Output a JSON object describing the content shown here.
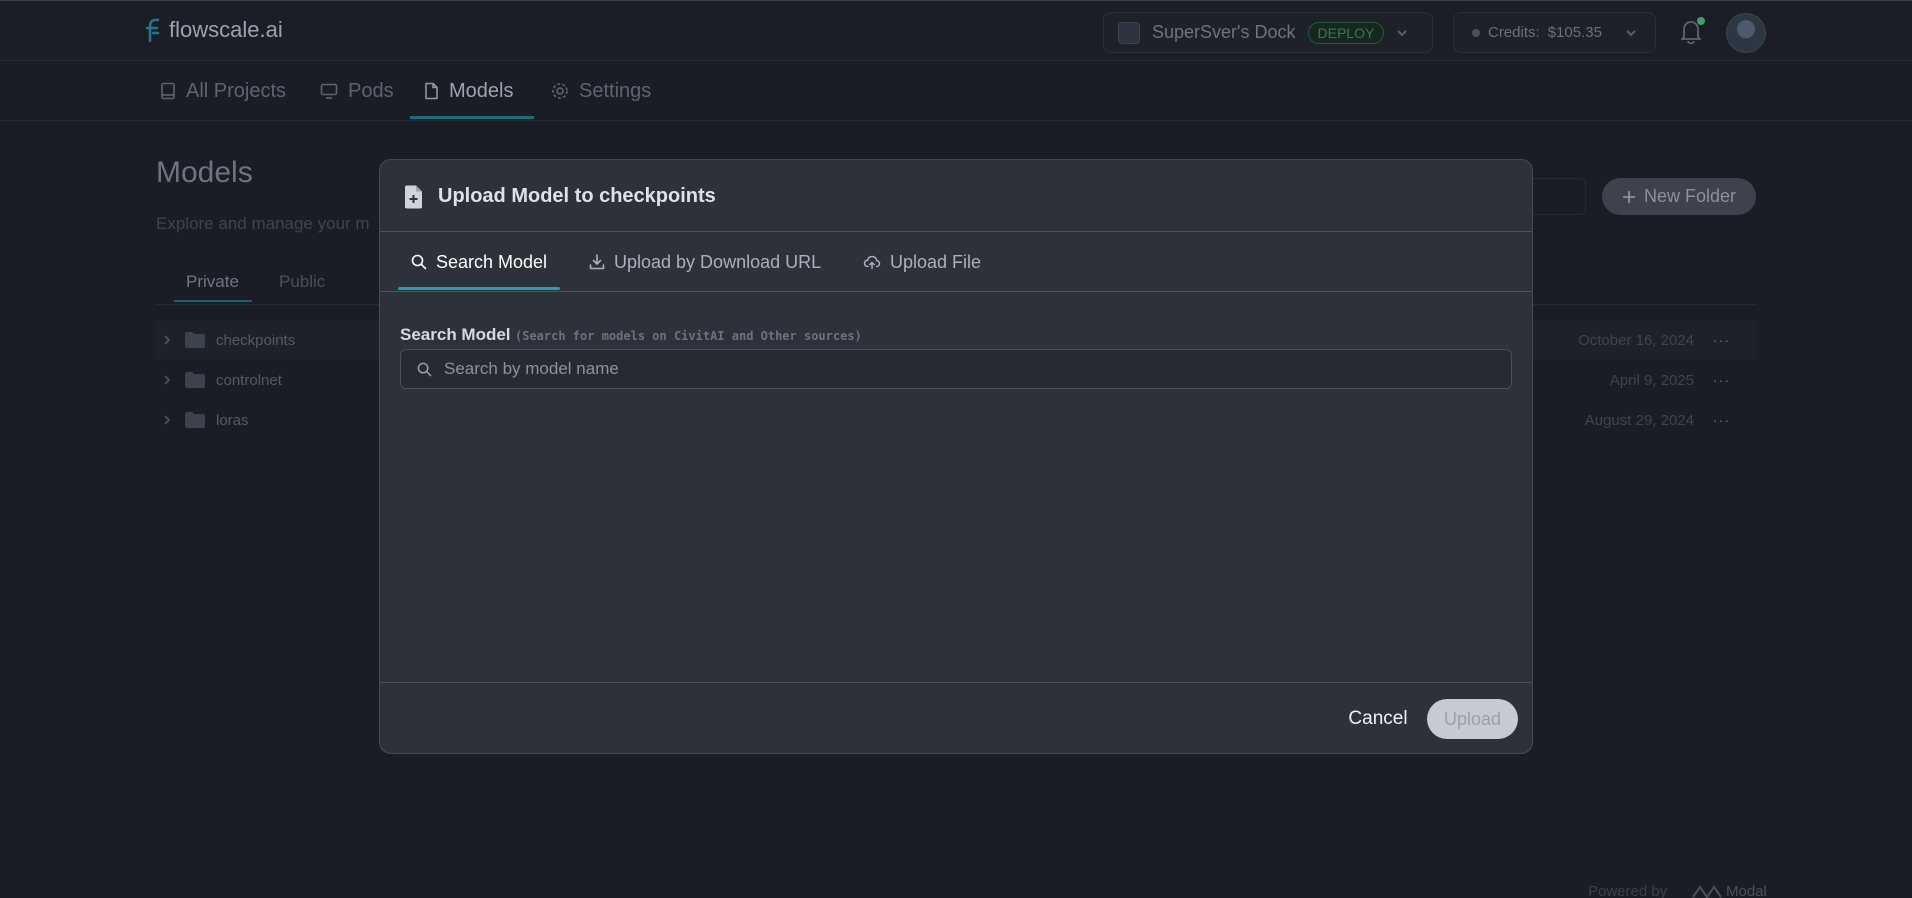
{
  "app": {
    "logo_text": "flowscale.ai",
    "project": {
      "name": "SuperSver's Dock",
      "badge": "DEPLOY"
    },
    "credits": {
      "label": "Credits:",
      "value": "$105.35"
    }
  },
  "nav": {
    "items": [
      {
        "label": "All Projects",
        "icon": "book-icon"
      },
      {
        "label": "Pods",
        "icon": "monitor-icon"
      },
      {
        "label": "Models",
        "icon": "file-icon",
        "active": true
      },
      {
        "label": "Settings",
        "icon": "gear-icon"
      }
    ]
  },
  "page": {
    "title": "Models",
    "subtitle": "Explore and manage your m",
    "new_folder_label": "New Folder",
    "tabs": [
      {
        "label": "Private",
        "active": true
      },
      {
        "label": "Public"
      }
    ],
    "folders": [
      {
        "name": "checkpoints",
        "date": "October 16, 2024"
      },
      {
        "name": "controlnet",
        "date": "April 9, 2025"
      },
      {
        "name": "loras",
        "date": "August 29, 2024"
      }
    ],
    "powered_by": "Powered by",
    "powered_brand": "Modal"
  },
  "modal": {
    "title": "Upload Model to checkpoints",
    "tabs": [
      {
        "label": "Search Model",
        "icon": "search-icon",
        "active": true
      },
      {
        "label": "Upload by Download URL",
        "icon": "download-icon"
      },
      {
        "label": "Upload File",
        "icon": "cloud-upload-icon"
      }
    ],
    "field_label": "Search Model",
    "field_hint": "(Search for models on CivitAI and Other sources)",
    "search_placeholder": "Search by model name",
    "search_value": "",
    "cancel_label": "Cancel",
    "upload_label": "Upload"
  },
  "colors": {
    "background": "#1a1d24",
    "modal_background": "#2d3139",
    "accent": "#1fa0c4",
    "upload_disabled": "#c7cbd1",
    "deploy_green": "#2e7d4f"
  }
}
